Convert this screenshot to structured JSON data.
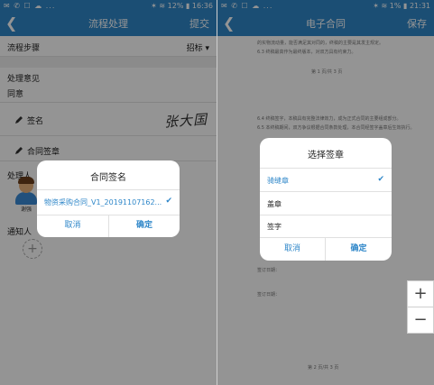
{
  "left": {
    "status": {
      "icons": "✉ ✆ ☐ ☁ ...",
      "right": "✶ ≋ 12% ▮ 16:36"
    },
    "nav": {
      "title": "流程处理",
      "action": "提交"
    },
    "flow_step_label": "流程步骤",
    "flow_step_value": "招标 ▾",
    "opinion_label": "处理意见",
    "opinion_value": "同意",
    "sign_label": "签名",
    "signature_text": "张大国",
    "seal_label": "合同签章",
    "handler_label": "处理人",
    "handler_name": "谢强",
    "notify_label": "通知人",
    "add_symbol": "+",
    "dialog": {
      "title": "合同签名",
      "file_name": "物资采购合同_V1_20191107162...",
      "cancel": "取消",
      "confirm": "确定"
    }
  },
  "right": {
    "status": {
      "icons": "✉ ✆ ☐ ☁ ...",
      "right": "✶ ≋ 1% ▮ 21:31"
    },
    "nav": {
      "title": "电子合同",
      "action": "保存"
    },
    "doc_lines": [
      "的实物流动量，能否满足其对同的，终稿的主要是其发主规定。",
      "6.3 终稿最高作为最终版本，对双方具有约束力。",
      "第 1 页/共 3 页",
      "6.4 终稿签字，本稿具有完整法律效力，成为正式合同的主要组成部分。",
      "6.5 本终稿期间，双方争议根据合同条款处理，本合同经签字盖章后生效执行。",
      "签订日期：",
      "签订日期：",
      "第 2 页/共 3 页"
    ],
    "dialog": {
      "title": "选择签章",
      "options": [
        "骑缝章",
        "盖章",
        "签字"
      ],
      "cancel": "取消",
      "confirm": "确定"
    },
    "zoom": {
      "plus": "+",
      "minus": "−"
    }
  },
  "colors": {
    "accent": "#2f87c9"
  }
}
